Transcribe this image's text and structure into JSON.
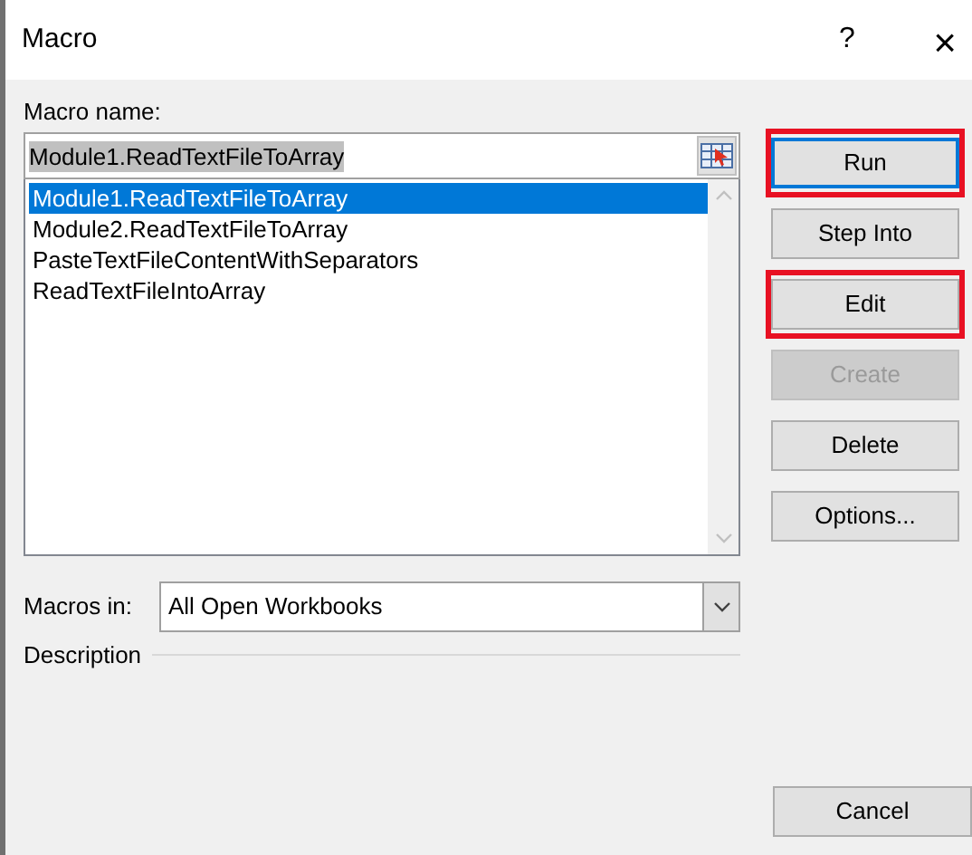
{
  "window": {
    "title": "Macro",
    "help": "?",
    "close": "×"
  },
  "macro_name": {
    "label": "Macro name:",
    "value": "Module1.ReadTextFileToArray"
  },
  "macros": [
    {
      "name": "Module1.ReadTextFileToArray",
      "selected": true
    },
    {
      "name": "Module2.ReadTextFileToArray",
      "selected": false
    },
    {
      "name": "PasteTextFileContentWithSeparators",
      "selected": false
    },
    {
      "name": "ReadTextFileIntoArray",
      "selected": false
    }
  ],
  "macros_in": {
    "label": "Macros in:",
    "value": "All Open Workbooks"
  },
  "description": {
    "label": "Description"
  },
  "buttons": [
    {
      "label": "Run",
      "highlighted": true,
      "focused": true,
      "disabled": false
    },
    {
      "label": "Step Into",
      "highlighted": false,
      "focused": false,
      "disabled": false
    },
    {
      "label": "Edit",
      "highlighted": true,
      "focused": false,
      "disabled": false
    },
    {
      "label": "Create",
      "highlighted": false,
      "focused": false,
      "disabled": true
    },
    {
      "label": "Delete",
      "highlighted": false,
      "focused": false,
      "disabled": false
    },
    {
      "label": "Options...",
      "highlighted": false,
      "focused": false,
      "disabled": false
    }
  ],
  "cancel": {
    "label": "Cancel"
  }
}
